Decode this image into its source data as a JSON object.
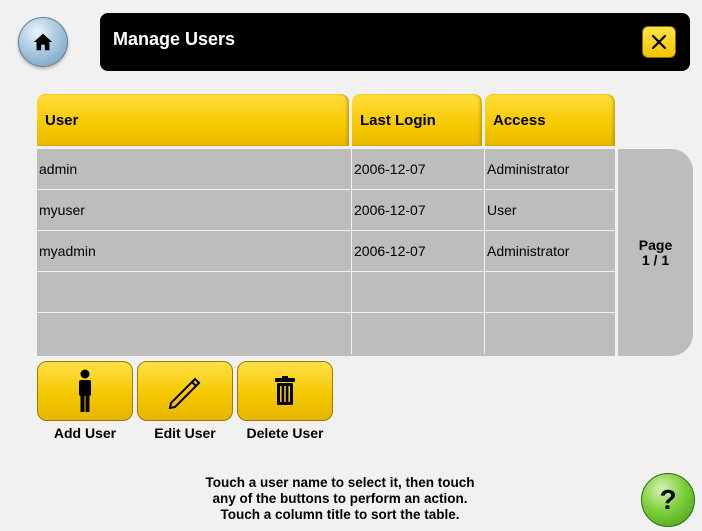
{
  "header": {
    "title": "Manage Users",
    "home_icon": "home-icon",
    "close_icon": "close-icon"
  },
  "table": {
    "columns": [
      "User",
      "Last Login",
      "Access"
    ],
    "rows": [
      {
        "user": "admin",
        "last_login": "2006-12-07",
        "access": "Administrator"
      },
      {
        "user": "myuser",
        "last_login": "2006-12-07",
        "access": "User"
      },
      {
        "user": "myadmin",
        "last_login": "2006-12-07",
        "access": "Administrator"
      },
      {
        "user": "",
        "last_login": "",
        "access": ""
      },
      {
        "user": "",
        "last_login": "",
        "access": ""
      }
    ]
  },
  "pagination": {
    "label": "Page",
    "value": "1 / 1"
  },
  "actions": {
    "add_label": "Add User",
    "edit_label": "Edit User",
    "delete_label": "Delete User",
    "add_icon": "person-icon",
    "edit_icon": "pencil-icon",
    "delete_icon": "trash-icon"
  },
  "help": {
    "lines": [
      "Touch a user name to select it, then touch",
      "any of the buttons to perform an action.",
      "Touch a column title to sort the table."
    ],
    "button_label": "?"
  },
  "colors": {
    "accent_yellow": "#f7c900",
    "title_bar": "#000000",
    "row_gray": "#bdbdbd",
    "help_green": "#5cb526",
    "home_blue": "#8fb4d0"
  }
}
